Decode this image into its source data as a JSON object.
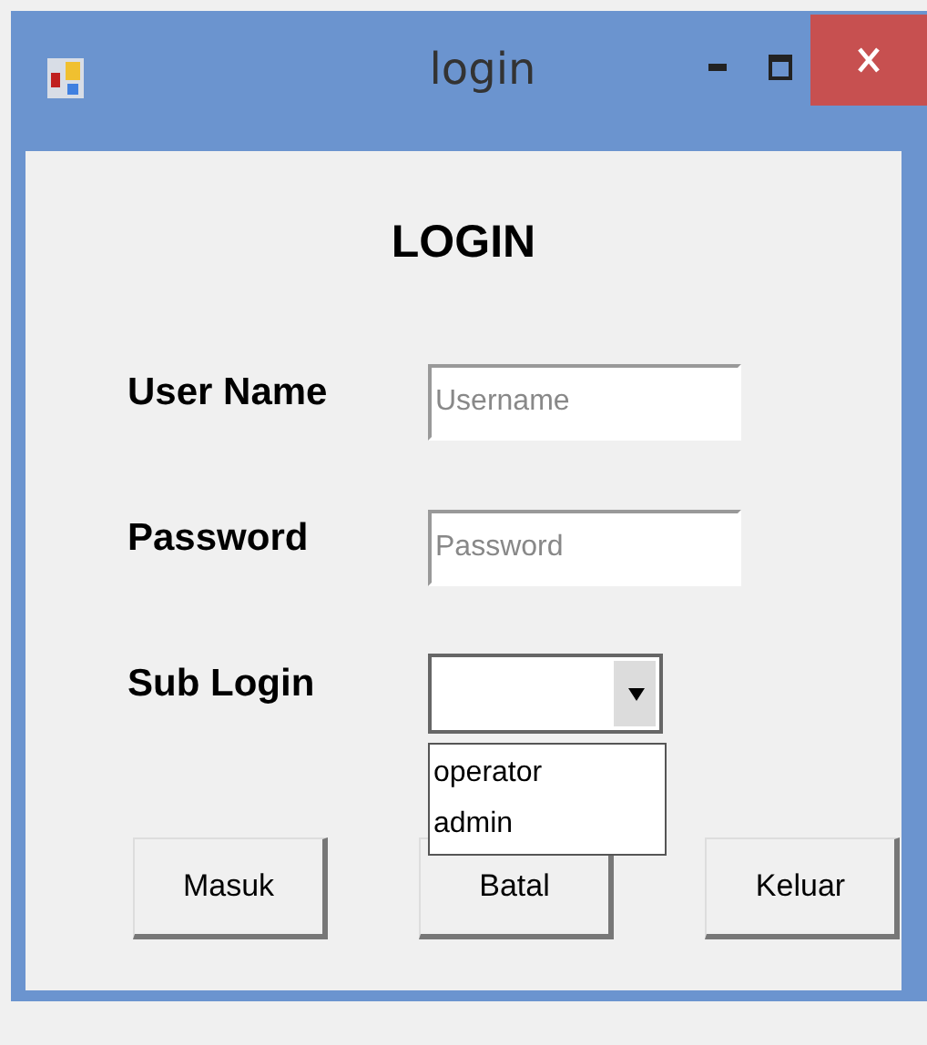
{
  "window": {
    "title": "login"
  },
  "heading": "LOGIN",
  "fields": [
    {
      "label": "User Name",
      "placeholder": "Username"
    },
    {
      "label": "Password",
      "placeholder": "Password"
    }
  ],
  "sub_login": {
    "label": "Sub Login",
    "expanded": true,
    "options": [
      {
        "label": "operator",
        "selected": false
      },
      {
        "label": "admin",
        "selected": false
      }
    ]
  },
  "buttons": [
    "Masuk",
    "Batal",
    "Keluar"
  ]
}
